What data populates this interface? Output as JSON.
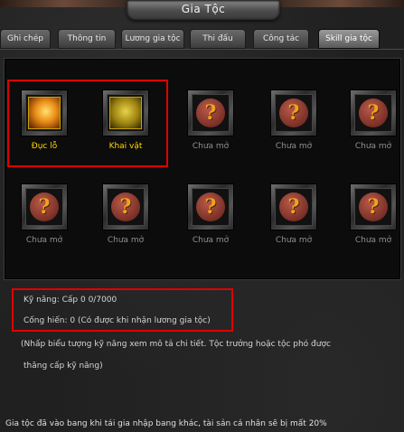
{
  "window": {
    "title": "Gia Tộc"
  },
  "tabs": [
    {
      "label": "Ghi chép",
      "active": false
    },
    {
      "label": "Thông tin",
      "active": false
    },
    {
      "label": "Lương gia tộc",
      "active": false
    },
    {
      "label": "Thi đấu",
      "active": false
    },
    {
      "label": "Công tác",
      "active": false
    },
    {
      "label": "Skill gia tộc",
      "active": true
    }
  ],
  "skills": [
    {
      "label": "Đục lỗ",
      "state": "learned",
      "icon": "ducloi-skill-icon"
    },
    {
      "label": "Khai vật",
      "state": "learned",
      "icon": "khaivat-skill-icon"
    },
    {
      "label": "Chưa mở",
      "state": "locked",
      "icon": "question-mark-icon"
    },
    {
      "label": "Chưa mở",
      "state": "locked",
      "icon": "question-mark-icon"
    },
    {
      "label": "Chưa mở",
      "state": "locked",
      "icon": "question-mark-icon"
    },
    {
      "label": "Chưa mở",
      "state": "locked",
      "icon": "question-mark-icon"
    },
    {
      "label": "Chưa mở",
      "state": "locked",
      "icon": "question-mark-icon"
    },
    {
      "label": "Chưa mở",
      "state": "locked",
      "icon": "question-mark-icon"
    },
    {
      "label": "Chưa mở",
      "state": "locked",
      "icon": "question-mark-icon"
    },
    {
      "label": "Chưa mở",
      "state": "locked",
      "icon": "question-mark-icon"
    }
  ],
  "question_mark_glyph": "?",
  "info": {
    "skill_line": "Kỹ năng: Cấp 0 0/7000",
    "contribution_line": "Cống hiến: 0 (Có được khi nhận lương gia tộc)",
    "hint_line1": "(Nhấp biểu tượng kỹ năng xem mô tả chi tiết. Tộc trưởng hoặc tộc phó được",
    "hint_line2": "thăng cấp kỹ năng)"
  },
  "footer": {
    "warning": "Gia tộc đã vào bang khi tái gia nhập bang khác, tài sản cá nhân sẽ bị mất 20%"
  },
  "colors": {
    "highlight_box": "#e00000",
    "learned_label": "#ffd800",
    "locked_label": "#8f8f8f"
  }
}
